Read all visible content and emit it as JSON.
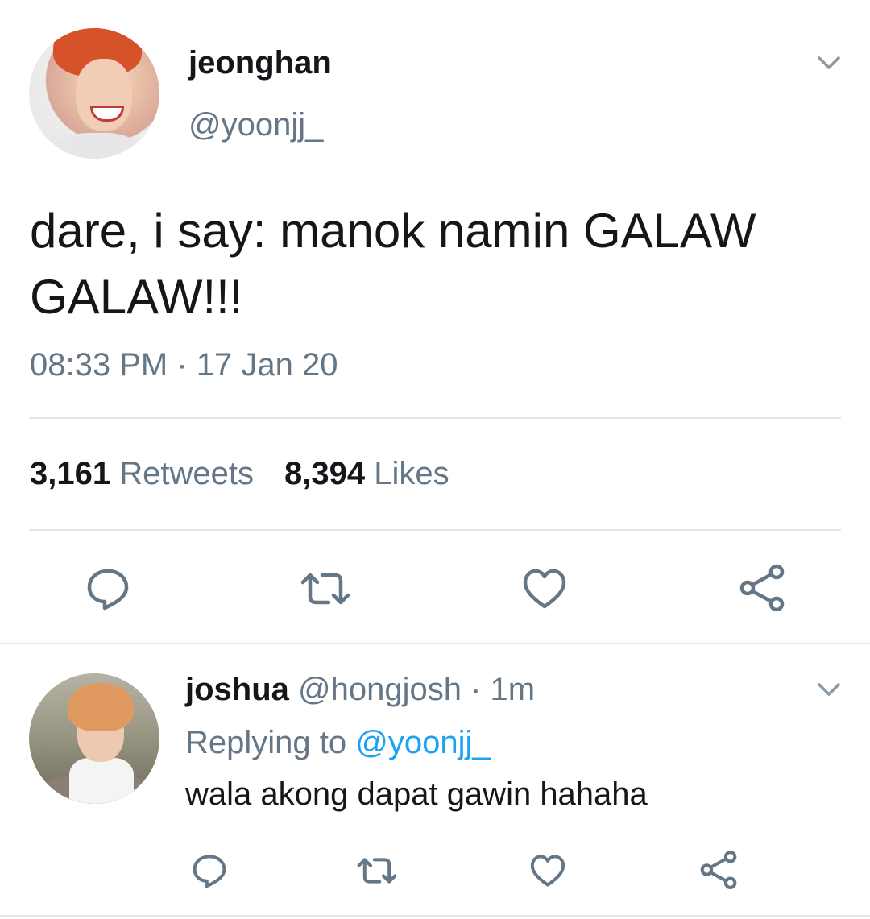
{
  "main_tweet": {
    "display_name": "jeonghan",
    "handle": "@yoonjj_",
    "text_line1": "dare, i say: manok namin GALAW",
    "text_line2": "GALAW!!!",
    "timestamp": "08:33 PM · 17 Jan 20",
    "retweets_count": "3,161",
    "retweets_label": "Retweets",
    "likes_count": "8,394",
    "likes_label": "Likes"
  },
  "reply_tweet": {
    "display_name": "joshua",
    "handle_time": "@hongjosh · 1m",
    "replying_prefix": "Replying to",
    "replying_mention": "@yoonjj_",
    "text": "wala akong dapat gawin hahaha"
  },
  "icons": {
    "menu": "chevron-down-icon",
    "reply": "comment-icon",
    "retweet": "retweet-icon",
    "like": "heart-icon",
    "share": "share-icon"
  },
  "colors": {
    "text": "#14171a",
    "secondary": "#657786",
    "accent": "#1da1f2",
    "divider": "#e1e8ed",
    "icon": "#657786"
  }
}
